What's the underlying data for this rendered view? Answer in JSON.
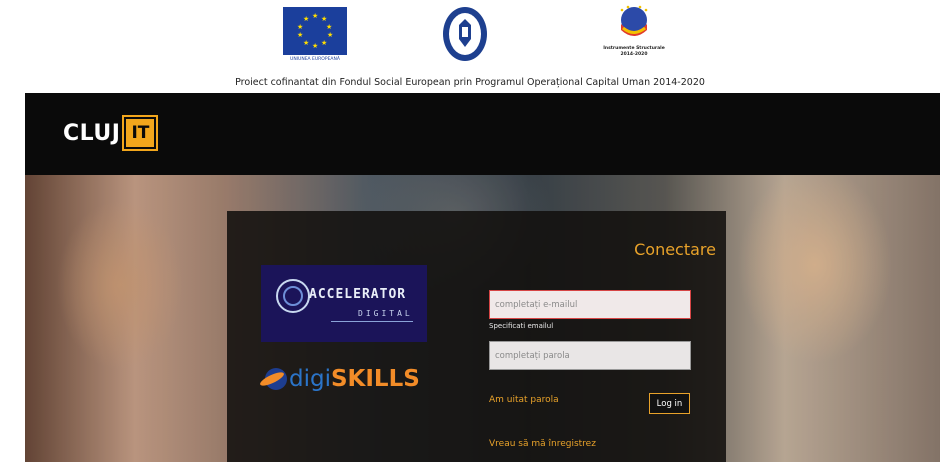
{
  "funding": {
    "eu_caption": "UNIUNEA EUROPEANĂ",
    "gov_label": "GUVERNUL ROMÂNIEI",
    "is_caption_line1": "Instrumente Structurale",
    "is_caption_line2": "2014-2020",
    "text": "Proiect cofinantat din Fondul Social European prin Programul Operațional Capital Uman 2014-2020"
  },
  "header": {
    "brand_word": "CLUJ",
    "brand_badge": "IT"
  },
  "login": {
    "title": "Conectare",
    "email_placeholder": "completați e-mailul",
    "email_help": "Specificati emailul",
    "password_placeholder": "completați parola",
    "forgot_link": "Am uitat parola",
    "login_button": "Log in",
    "register_link": "Vreau să mă înregistrez"
  },
  "partners": {
    "accelerator_word": "ACCELERATOR",
    "accelerator_sub": "DIGITAL",
    "digi_prefix": "digi",
    "digi_suffix": "SKILLS"
  },
  "colors": {
    "accent": "#e8a22a",
    "header_bg": "#0a0a0a",
    "eu_blue": "#1b3f9c",
    "error_border": "#d64545"
  }
}
